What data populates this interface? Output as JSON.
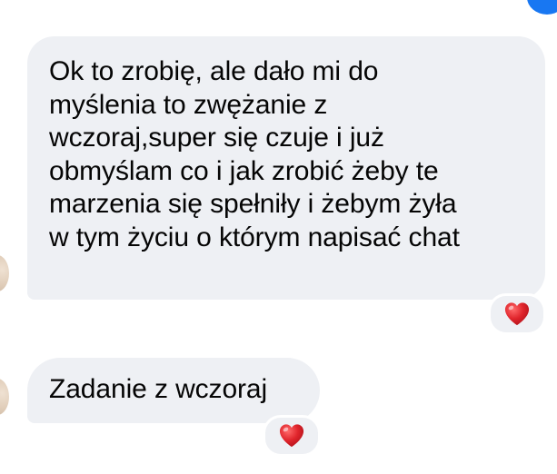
{
  "conversation": {
    "messages": [
      {
        "lines": [
          "Ok to zrobię, ale dało mi do",
          "myślenia to zwężanie z",
          "wczoraj,super się czuje i już",
          "obmyślam co i jak zrobić żeby te",
          "marzenia się spełniły i żebym żyła",
          "w tym życiu o którym napisać chat"
        ],
        "reaction": "red-heart"
      },
      {
        "text": "Zadanie z wczoraj",
        "reaction": "red-heart"
      }
    ]
  },
  "colors": {
    "bubble_bg": "#eef0f4",
    "text": "#050505",
    "heart": "#e0252c",
    "accent": "#1877f2"
  }
}
